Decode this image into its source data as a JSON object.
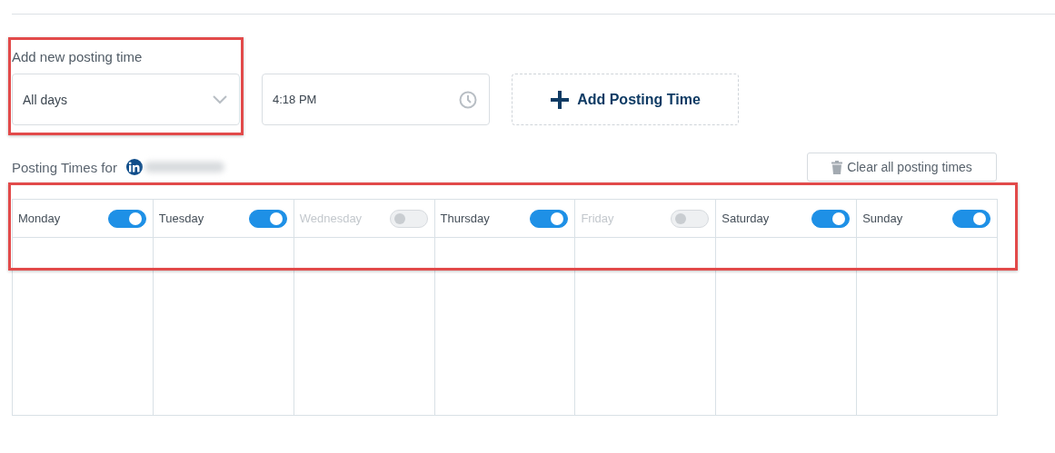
{
  "form": {
    "title": "Add new posting time",
    "day_select": {
      "value": "All days"
    },
    "time_field": {
      "value": "4:18 PM"
    },
    "add_button": {
      "label": "Add Posting Time"
    }
  },
  "schedule": {
    "title": "Posting Times for",
    "clear_button": {
      "label": "Clear all posting times"
    },
    "days": [
      {
        "label": "Monday",
        "on": true
      },
      {
        "label": "Tuesday",
        "on": true
      },
      {
        "label": "Wednesday",
        "on": false
      },
      {
        "label": "Thursday",
        "on": true
      },
      {
        "label": "Friday",
        "on": false
      },
      {
        "label": "Saturday",
        "on": true
      },
      {
        "label": "Sunday",
        "on": true
      }
    ]
  }
}
